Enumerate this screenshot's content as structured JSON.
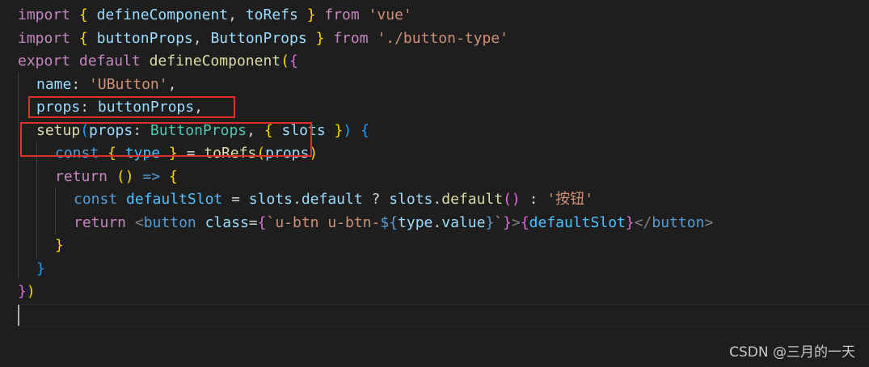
{
  "code": {
    "l1": {
      "import": "import",
      "ob": "{",
      "a": "defineComponent",
      "comma": ",",
      "b": "toRefs",
      "cb": "}",
      "from": "from",
      "src": "'vue'"
    },
    "l2": {
      "import": "import",
      "ob": "{",
      "a": "buttonProps",
      "comma": ",",
      "b": "ButtonProps",
      "cb": "}",
      "from": "from",
      "src": "'./button-type'"
    },
    "l3": {
      "export": "export",
      "default": "default",
      "fn": "defineComponent",
      "op": "(",
      "ob": "{"
    },
    "l4": {
      "key": "name",
      "colon": ":",
      "val": "'UButton'",
      "comma": ","
    },
    "l5": {
      "key": "props",
      "colon": ":",
      "val": "buttonProps",
      "comma": ","
    },
    "l6": {
      "fn": "setup",
      "op": "(",
      "param": "props",
      "colon": ":",
      "type": "ButtonProps",
      "comma": ",",
      "ob": "{",
      "slots": "slots",
      "cb": "}",
      "cp": ")",
      "body": "{"
    },
    "l7": {
      "const": "const",
      "ob": "{",
      "var": "type",
      "cb": "}",
      "eq": "=",
      "fn": "toRefs",
      "op": "(",
      "arg": "props",
      "cp": ")"
    },
    "l8": {
      "return": "return",
      "paren": "()",
      "arrow": "=>",
      "ob": "{"
    },
    "l9": {
      "const": "const",
      "var": "defaultSlot",
      "eq": "=",
      "obj1": "slots",
      "dot1": ".",
      "prop1": "default",
      "q": "?",
      "obj2": "slots",
      "dot2": ".",
      "fn": "default",
      "call": "()",
      "colon": ":",
      "str": "'按钮'"
    },
    "l10": {
      "return": "return",
      "lt": "<",
      "tag": "button",
      "attr": "class",
      "eq": "=",
      "ob": "{",
      "tick": "`",
      "tpl": "u-btn u-btn-",
      "dollar": "${",
      "obj": "type",
      "dot": ".",
      "prop": "value",
      "close": "}",
      "tick2": "`",
      "cb": "}",
      "gt": ">",
      "ob2": "{",
      "child": "defaultSlot",
      "cb2": "}",
      "endtag": "</",
      "tag2": "button",
      "gt2": ">"
    },
    "l11": {
      "cb": "}"
    },
    "l12": {
      "cb": "}"
    },
    "l13": {
      "cb": "}",
      "cp": ")"
    }
  },
  "watermark": "CSDN @三月的一天",
  "colors": {
    "background": "#1e1e1e",
    "highlight_box": "#e0302a"
  }
}
